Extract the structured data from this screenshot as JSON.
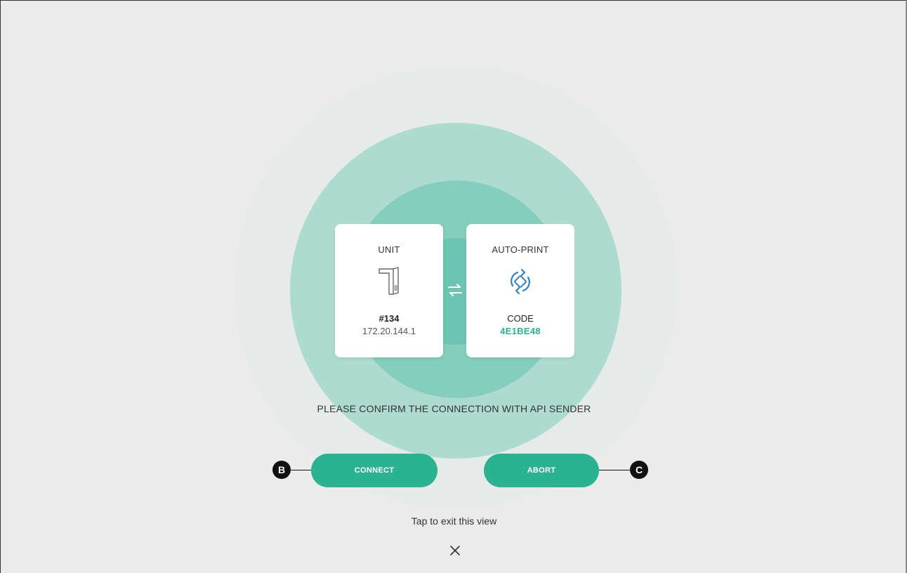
{
  "unit_card": {
    "title": "UNIT",
    "icon": "unit-device-icon",
    "number": "#134",
    "ip": "172.20.144.1"
  },
  "autoprint_card": {
    "title": "AUTO-PRINT",
    "icon": "sync-icon",
    "code_label": "CODE",
    "code_value": "4E1BE48"
  },
  "connection_icon": "swap-arrows-icon",
  "prompt": "PLEASE CONFIRM THE CONNECTION WITH API SENDER",
  "buttons": {
    "connect": "CONNECT",
    "abort": "ABORT"
  },
  "callouts": {
    "b": "B",
    "c": "C"
  },
  "exit_text": "Tap to exit this view",
  "close_icon": "close-icon",
  "colors": {
    "accent": "#2bb38f",
    "background": "#ebebeb",
    "icon_blue": "#2f80c3"
  }
}
